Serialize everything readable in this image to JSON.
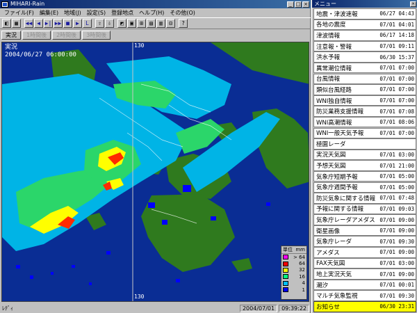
{
  "app": {
    "title": "MIHARI-Rain",
    "menus": [
      "ファイル(F)",
      "編集(E)",
      "地域(J)",
      "設定(S)",
      "登録地点",
      "ヘルプ(H)",
      "その他(O)"
    ],
    "toolbar": [
      "◧",
      "▦",
      "◀◀",
      "◀",
      "▶|",
      "▶▶",
      "■",
      "▶",
      "L",
      "⇧",
      "⇩",
      "◩",
      "▣",
      "⊞",
      "▤",
      "▥",
      "⊟",
      "?"
    ],
    "tabs": [
      {
        "label": "実況",
        "enabled": true
      },
      {
        "label": "1時間後",
        "enabled": false
      },
      {
        "label": "2時間後",
        "enabled": false
      },
      {
        "label": "3時間後",
        "enabled": false
      }
    ],
    "status_left": "ﾚﾃﾞｨ",
    "status_date": "2004/07/01",
    "status_time": "09:39:22"
  },
  "map": {
    "mode_label": "実況",
    "timestamp": "2004/06/27 06:00:00",
    "lon_top": "130",
    "lon_bottom": "130",
    "legend": {
      "title": "単位",
      "unit": "mm",
      "levels": [
        {
          "label": "> 64",
          "color": "#ff00ff"
        },
        {
          "label": "64",
          "color": "#ff0000"
        },
        {
          "label": "32",
          "color": "#ffff00"
        },
        {
          "label": "16",
          "color": "#00ff80"
        },
        {
          "label": "4",
          "color": "#00c0ff"
        },
        {
          "label": "1",
          "color": "#0000ff"
        }
      ]
    }
  },
  "menu_window": {
    "title": "メニュー",
    "items": [
      {
        "label": "地震・津波速報",
        "time": "06/27 04:43"
      },
      {
        "label": "各地の震度",
        "time": "07/01 04:01"
      },
      {
        "label": "津波情報",
        "time": "06/17 14:18"
      },
      {
        "label": "注意報・警報",
        "time": "07/01 09:11"
      },
      {
        "label": "洪水予報",
        "time": "06/30 15:37"
      },
      {
        "label": "異常潮位情報",
        "time": "07/01 07:00"
      },
      {
        "label": "台風情報",
        "time": "07/01 07:00"
      },
      {
        "label": "類似台風経路",
        "time": "07/01 07:00"
      },
      {
        "label": "WNI独自情報",
        "time": "07/01 07:00"
      },
      {
        "label": "防災業務支援情報",
        "time": "07/01 07:08"
      },
      {
        "label": "WNI高潮情報",
        "time": "07/01 08:06"
      },
      {
        "label": "WNI一般天気予報",
        "time": "07/01 07:00"
      },
      {
        "label": "極園レーダ",
        "time": ""
      },
      {
        "label": "実況天気図",
        "time": "07/01 03:00"
      },
      {
        "label": "予想天気図",
        "time": "07/01 21:00"
      },
      {
        "label": "気象庁短期予報",
        "time": "07/01 05:00"
      },
      {
        "label": "気象庁週間予報",
        "time": "07/01 05:00"
      },
      {
        "label": "防災気象に関する情報",
        "time": "07/01 07:48"
      },
      {
        "label": "予報に関する情報",
        "time": "07/01 09:03"
      },
      {
        "label": "気象庁レーダアメダス",
        "time": "07/01 09:00"
      },
      {
        "label": "衛星画像",
        "time": "07/01 09:00"
      },
      {
        "label": "気象庁レーダ",
        "time": "07/01 09:30"
      },
      {
        "label": "アメダス",
        "time": "07/01 09:00"
      },
      {
        "label": "FAX天気図",
        "time": "07/01 03:00"
      },
      {
        "label": "地上実況天気",
        "time": "07/01 09:00"
      },
      {
        "label": "潮汐",
        "time": "07/01 00:01"
      },
      {
        "label": "マルチ気象監視",
        "time": "07/01 09:30"
      },
      {
        "label": "お知らせ",
        "time": "06/30 23:31",
        "highlight": true
      }
    ]
  }
}
